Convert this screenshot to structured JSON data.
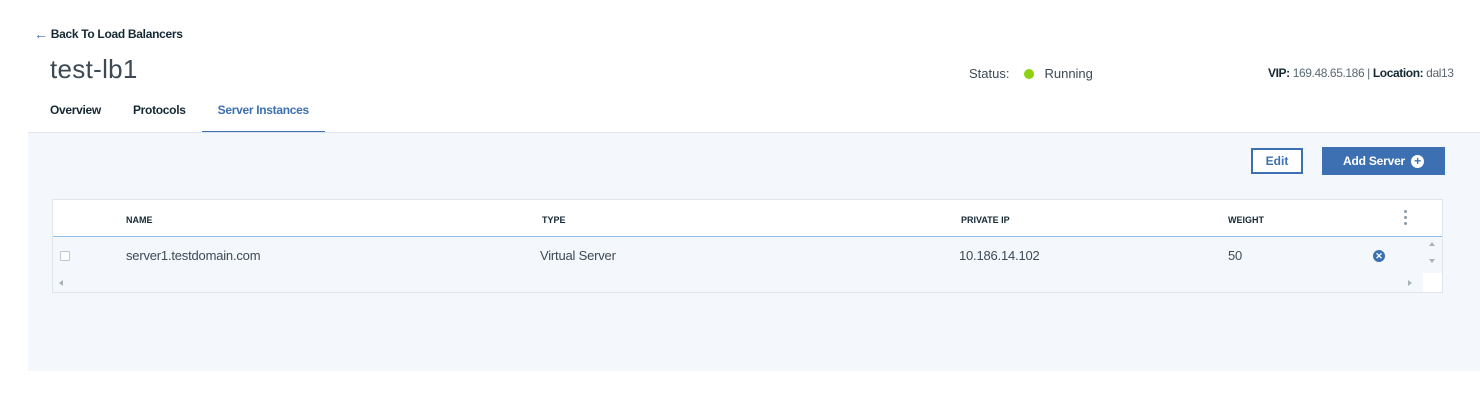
{
  "nav": {
    "back_label": "Back To Load Balancers"
  },
  "header": {
    "title": "test-lb1",
    "status_label": "Status:",
    "status_value": "Running",
    "status_color": "#8cd211",
    "vip_label": "VIP:",
    "vip_value": "169.48.65.186",
    "separator": "|",
    "location_label": "Location:",
    "location_value": "dal13"
  },
  "tabs": [
    {
      "label": "Overview",
      "active": false
    },
    {
      "label": "Protocols",
      "active": false
    },
    {
      "label": "Server Instances",
      "active": true
    }
  ],
  "toolbar": {
    "edit_label": "Edit",
    "add_label": "Add Server",
    "add_icon": "plus-circle-icon"
  },
  "table": {
    "columns": [
      "NAME",
      "TYPE",
      "PRIVATE IP",
      "WEIGHT"
    ],
    "rows": [
      {
        "name": "server1.testdomain.com",
        "type": "Virtual Server",
        "private_ip": "10.186.14.102",
        "weight": "50"
      }
    ],
    "menu_icon": "kebab-menu-icon",
    "remove_icon": "remove-circle-icon"
  },
  "colors": {
    "accent": "#3d70b2",
    "panel_bg": "#f4f7fb",
    "running": "#8cd211"
  }
}
